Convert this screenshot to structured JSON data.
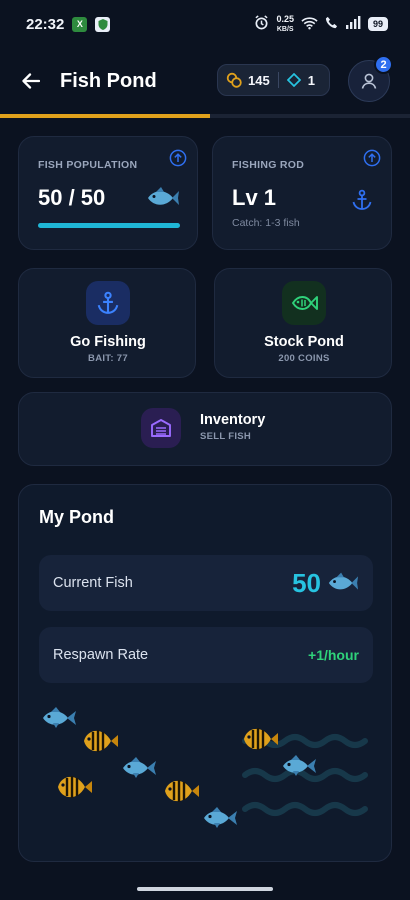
{
  "status_bar": {
    "time": "22:32",
    "speed_value": "0.25",
    "speed_unit": "KB/S",
    "battery": "99"
  },
  "header": {
    "title": "Fish Pond",
    "coins": "145",
    "gems": "1",
    "notification_count": "2"
  },
  "population_card": {
    "label": "FISH POPULATION",
    "value": "50 / 50",
    "fill_fraction": 1.0
  },
  "rod_card": {
    "label": "FISHING ROD",
    "level": "Lv 1",
    "catch": "Catch: 1-3 fish"
  },
  "go_fishing": {
    "title": "Go Fishing",
    "sub": "BAIT: 77"
  },
  "stock_pond": {
    "title": "Stock Pond",
    "sub": "200 COINS"
  },
  "inventory": {
    "title": "Inventory",
    "sub": "SELL FISH"
  },
  "my_pond": {
    "title": "My Pond",
    "current_label": "Current Fish",
    "current_value": "50",
    "respawn_label": "Respawn Rate",
    "respawn_value": "+1/hour"
  },
  "colors": {
    "accent_cyan": "#27c3e0",
    "accent_gold": "#e0a11c",
    "accent_green": "#2fd27a",
    "card_bg": "#121c2e"
  }
}
